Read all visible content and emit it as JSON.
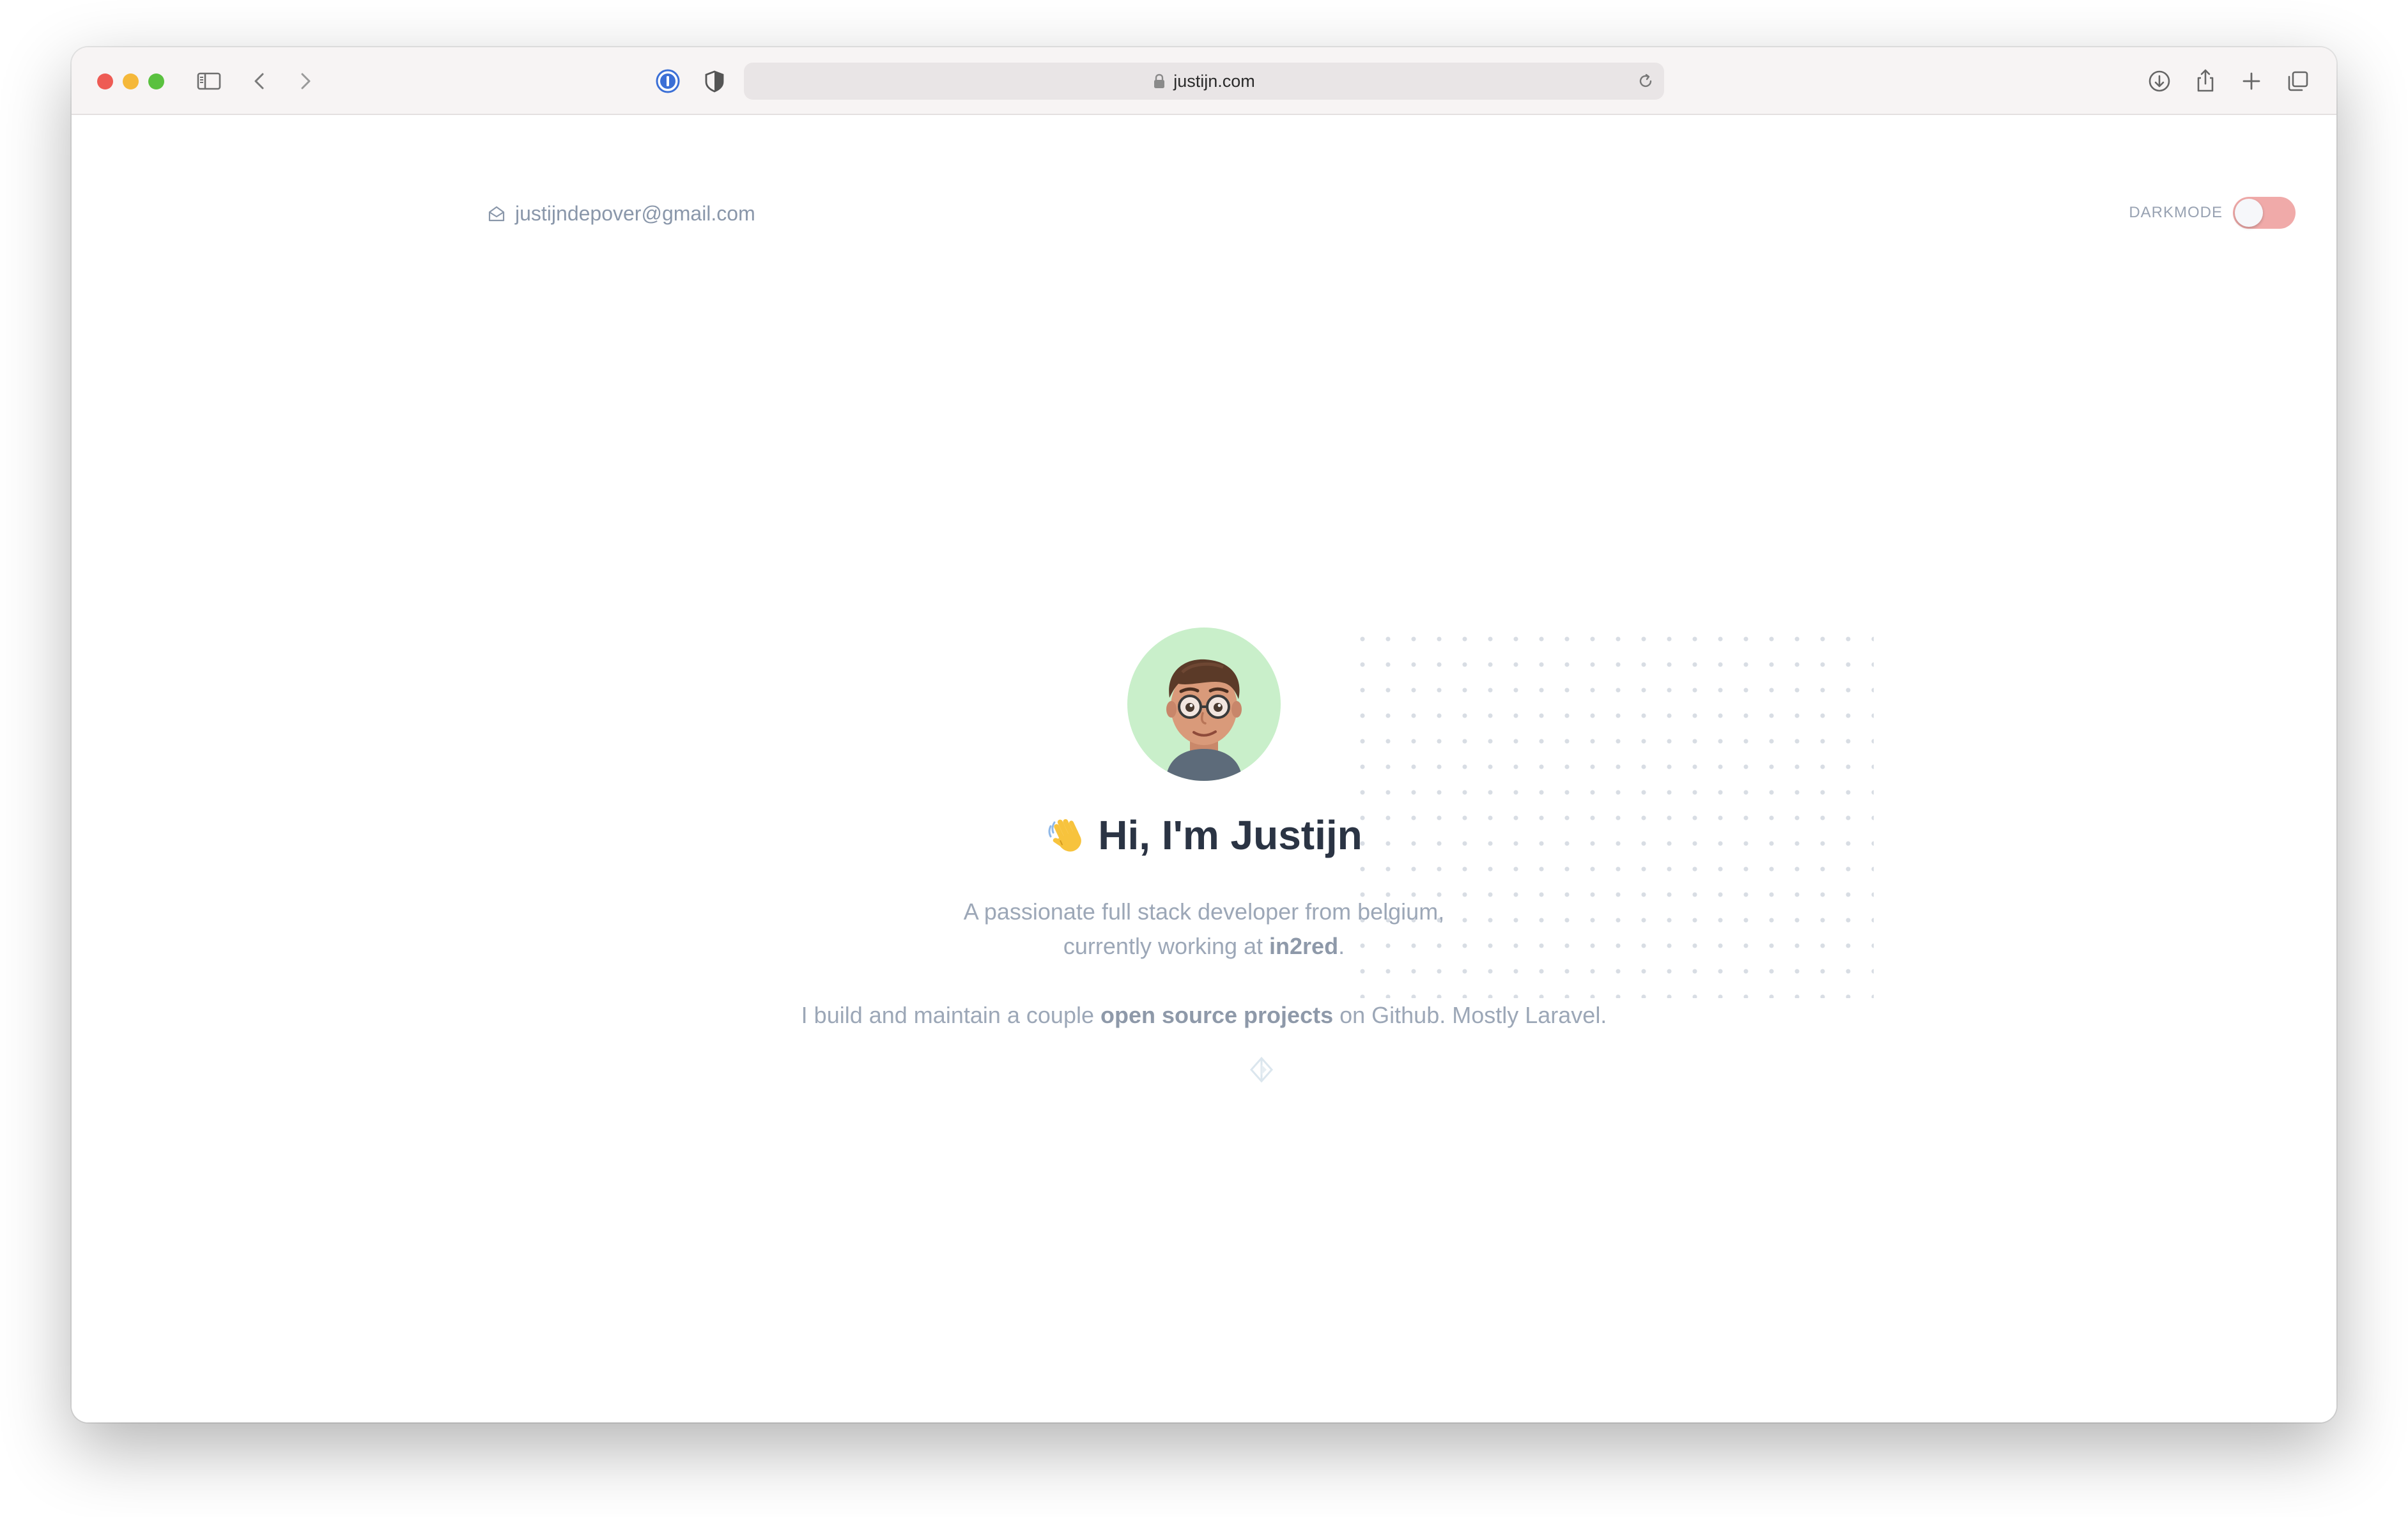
{
  "browser": {
    "url": "justijn.com"
  },
  "header": {
    "email": "justijndepover@gmail.com",
    "darkmode_label": "DARKMODE",
    "darkmode_enabled": false
  },
  "hero": {
    "heading": "Hi, I'm Justijn",
    "intro_line1": "A passionate full stack developer from belgium,",
    "intro_line2_prefix": "currently working at ",
    "company": "in2red",
    "intro_line2_suffix": ".",
    "oss_prefix": "I build and maintain a couple ",
    "oss_link": "open source projects",
    "oss_suffix": " on Github. Mostly Laravel."
  },
  "colors": {
    "avatar_bg": "#c9efca",
    "toggle_bg": "#f0aaa9",
    "heading": "#2b3444",
    "muted_text": "#9ca7b7"
  },
  "icons": [
    "sidebar-icon",
    "back-chevron-icon",
    "forward-chevron-icon",
    "password-manager-icon",
    "shield-icon",
    "lock-icon",
    "reload-icon",
    "download-icon",
    "share-icon",
    "new-tab-icon",
    "tab-overview-icon",
    "mail-icon",
    "waving-hand-icon"
  ]
}
